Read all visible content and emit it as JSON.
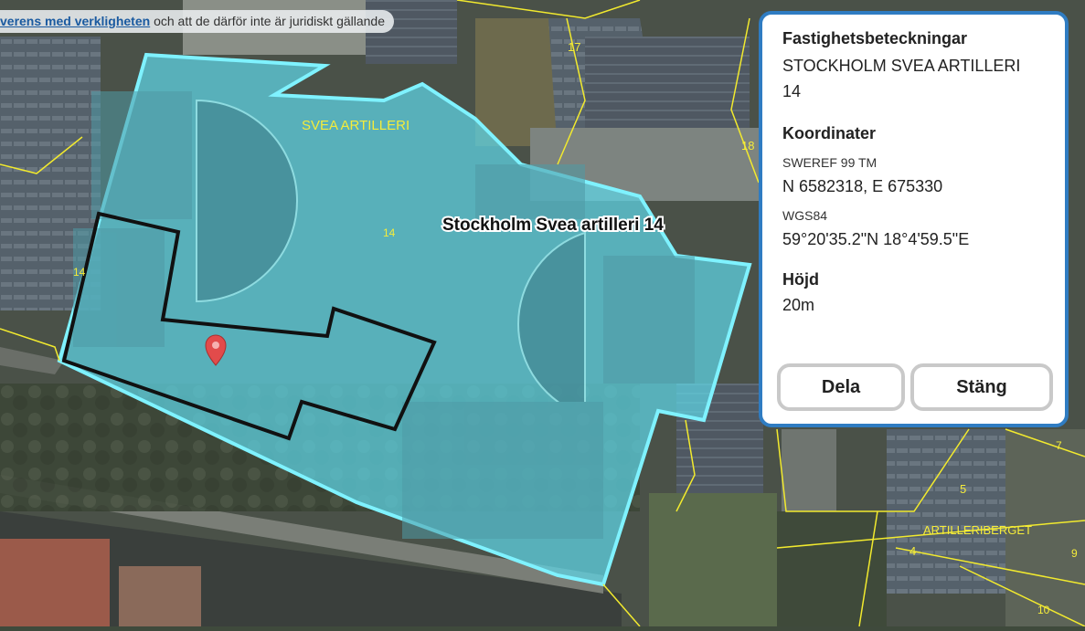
{
  "notice": {
    "link_text": "verens med verkligheten",
    "rest_text": " och att de därför inte är juridiskt gällande"
  },
  "map": {
    "property_label": "Stockholm Svea artilleri 14",
    "district_label_1": "SVEA ARTILLERI",
    "district_label_2": "ARTILLERIBERGET",
    "parcel_numbers": [
      "17",
      "18",
      "14",
      "14",
      "5",
      "4",
      "7",
      "9",
      "10"
    ],
    "highlight_color": "#5ed6e6",
    "outline_color": "#7ff2ff",
    "marker_icon": "map-pin-icon",
    "marker_color": "#e24b4b"
  },
  "panel": {
    "properties_heading": "Fastighetsbeteckningar",
    "properties_value_line1": "STOCKHOLM SVEA ARTILLERI",
    "properties_value_line2": "14",
    "coords_heading": "Koordinater",
    "sweref_label": "SWEREF 99 TM",
    "sweref_value": "N 6582318, E 675330",
    "wgs_label": "WGS84",
    "wgs_value": "59°20'35.2\"N 18°4'59.5\"E",
    "height_heading": "Höjd",
    "height_value": "20m",
    "share_button": "Dela",
    "close_button": "Stäng",
    "border_color": "#2f7cc2"
  }
}
